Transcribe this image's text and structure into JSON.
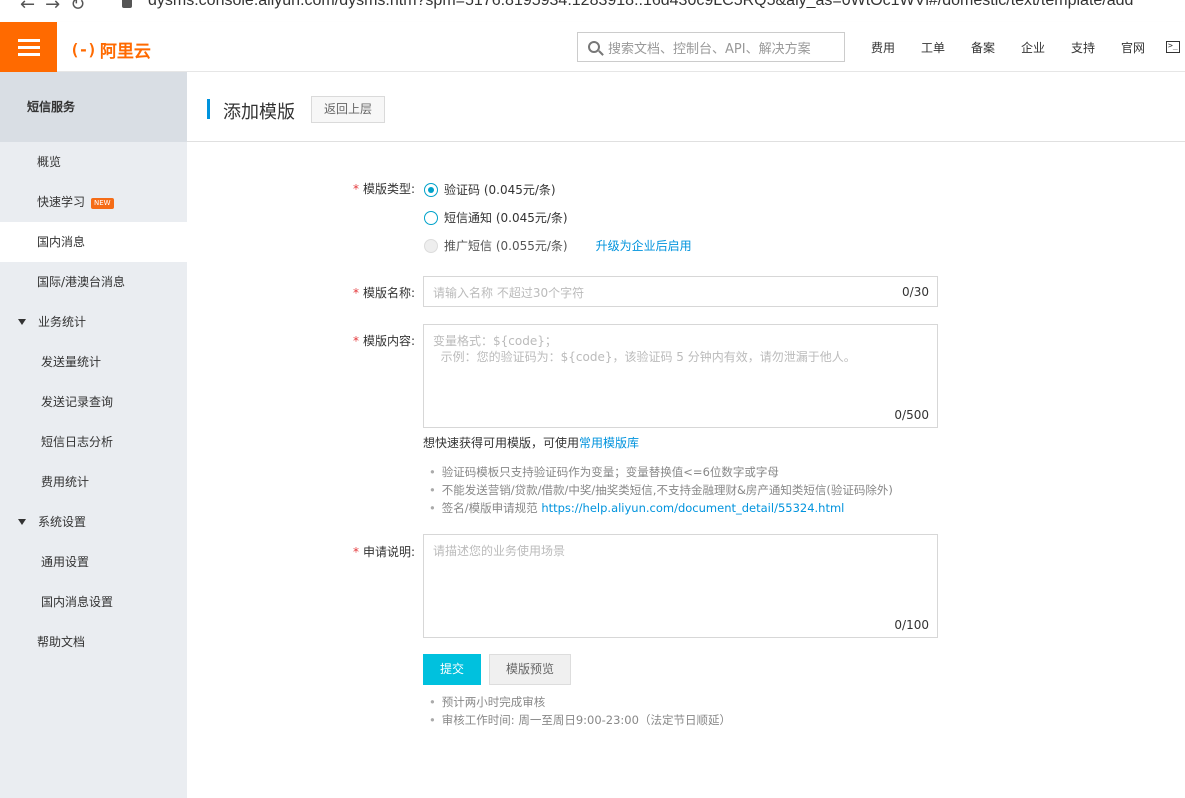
{
  "browser": {
    "url": "dysms.console.aliyun.com/dysms.htm?spm=5176.8195934.1283918..16d430c9LC5RQ5&aly_as=0WtOc1WVl#/domestic/text/template/add"
  },
  "topbar": {
    "logo_text": "阿里云",
    "logo_mark": "(-)",
    "search_placeholder": "搜索文档、控制台、API、解决方案",
    "nav": [
      "费用",
      "工单",
      "备案",
      "企业",
      "支持",
      "官网"
    ],
    "accent": "#ff6a00"
  },
  "sidebar": {
    "title": "短信服务",
    "items": [
      {
        "label": "概览"
      },
      {
        "label": "快速学习",
        "badge": "NEW"
      },
      {
        "label": "国内消息",
        "active": true
      },
      {
        "label": "国际/港澳台消息"
      },
      {
        "label": "业务统计",
        "group": true
      },
      {
        "label": "发送量统计"
      },
      {
        "label": "发送记录查询"
      },
      {
        "label": "短信日志分析"
      },
      {
        "label": "费用统计"
      },
      {
        "label": "系统设置",
        "group": true
      },
      {
        "label": "通用设置"
      },
      {
        "label": "国内消息设置"
      },
      {
        "label": "帮助文档"
      }
    ]
  },
  "page": {
    "title": "添加模版",
    "back_button": "返回上层"
  },
  "form": {
    "type_label": "模版类型:",
    "types": [
      {
        "label": "验证码 (0.045元/条)",
        "selected": true
      },
      {
        "label": "短信通知 (0.045元/条)",
        "selected": false
      },
      {
        "label": "推广短信 (0.055元/条)",
        "disabled": true,
        "link": "升级为企业后启用"
      }
    ],
    "name_label": "模版名称:",
    "name_placeholder": "请输入名称 不超过30个字符",
    "name_count": "0/30",
    "content_label": "模版内容:",
    "content_placeholder": "变量格式：${code}；\n  示例：您的验证码为：${code}，该验证码 5 分钟内有效，请勿泄漏于他人。",
    "content_count": "0/500",
    "content_hint": "想快速获得可用模版，可使用",
    "content_hint_link": "常用模版库",
    "tips": [
      "验证码模板只支持验证码作为变量；变量替换值<=6位数字或字母",
      "不能发送营销/贷款/借款/中奖/抽奖类短信,不支持金融理财&房产通知类短信(验证码除外)"
    ],
    "tip_spec_prefix": "签名/模版申请规范",
    "tip_spec_link": "https://help.aliyun.com/document_detail/55324.html",
    "desc_label": "申请说明:",
    "desc_placeholder": "请描述您的业务使用场景",
    "desc_count": "0/100",
    "submit": "提交",
    "preview": "模版预览",
    "footer_tips": [
      "预计两小时完成审核",
      "审核工作时间: 周一至周日9:00-23:00（法定节日顺延）"
    ]
  }
}
